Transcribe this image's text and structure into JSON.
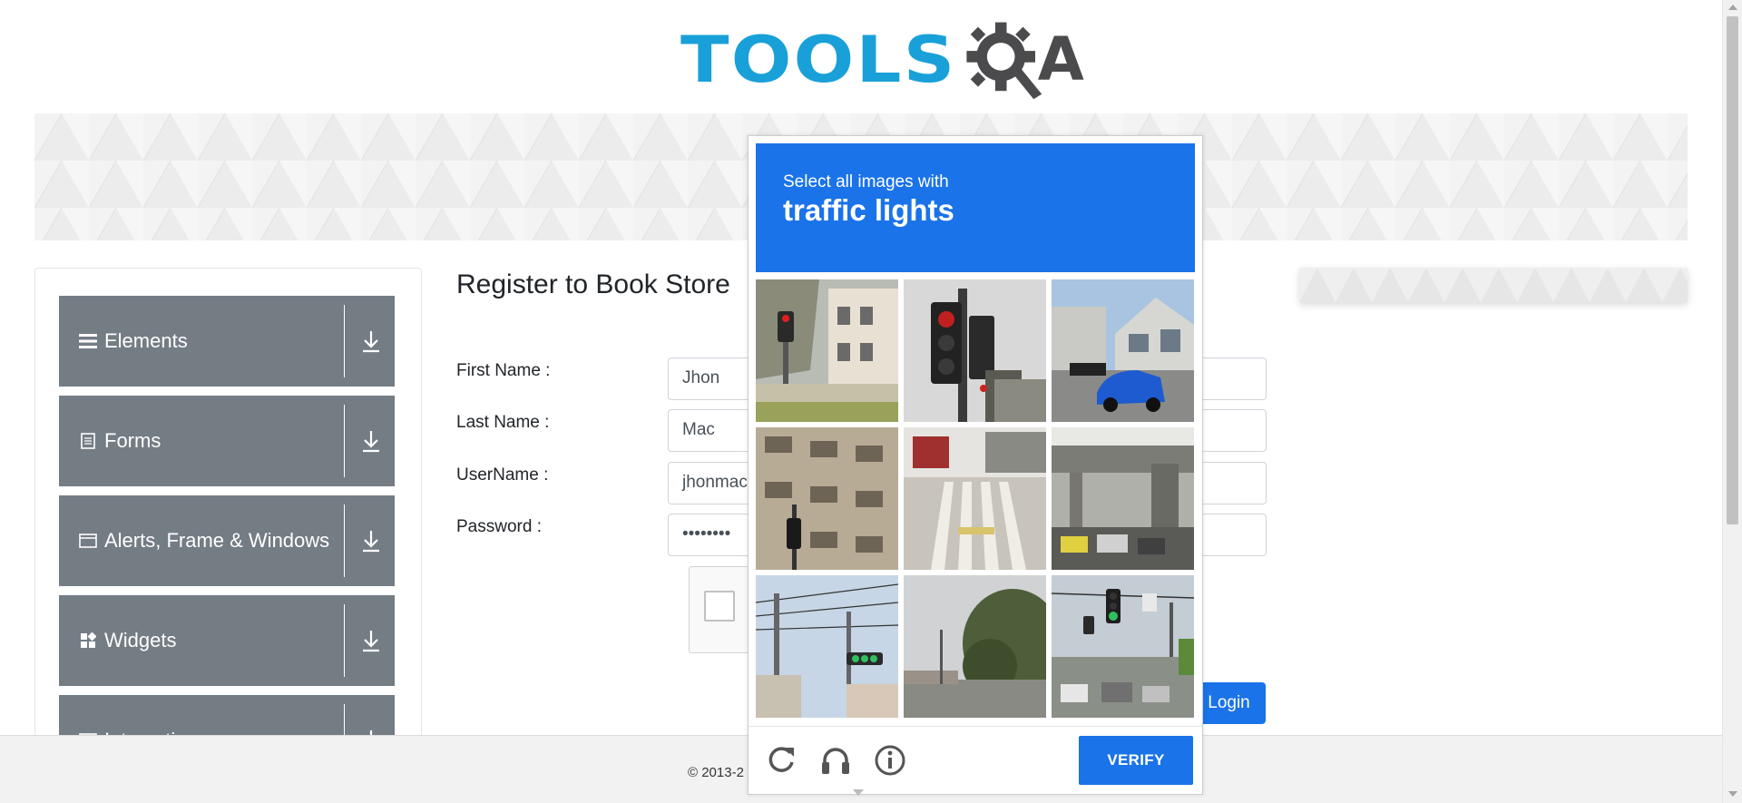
{
  "header": {
    "logo_text": "TOOLSQA",
    "logo_left": "TOOLS",
    "logo_right": "A"
  },
  "sidebar": {
    "groups": [
      {
        "label": "Elements",
        "icon": "hamburger-icon"
      },
      {
        "label": "Forms",
        "icon": "document-icon"
      },
      {
        "label": "Alerts, Frame & Windows",
        "icon": "window-icon"
      },
      {
        "label": "Widgets",
        "icon": "widgets-icon"
      },
      {
        "label": "Interactions",
        "icon": "interactions-icon"
      }
    ]
  },
  "form": {
    "title": "Register to Book Store",
    "fields": [
      {
        "label": "First Name :",
        "value": "Jhon"
      },
      {
        "label": "Last Name :",
        "value": "Mac"
      },
      {
        "label": "UserName :",
        "value": "jhonmac"
      },
      {
        "label": "Password :",
        "value": "••••••••"
      }
    ],
    "login_label": "Login"
  },
  "footer": {
    "text": "© 2013-2"
  },
  "challenge": {
    "instruction": "Select all images with",
    "target": "traffic lights",
    "verify_label": "VERIFY",
    "tiles": [
      "street-corner-with-traffic-light",
      "traffic-light-close-up",
      "house-with-blue-car",
      "building-with-traffic-light",
      "crosswalk-street",
      "overpass-with-cars",
      "power-lines-with-traffic-light",
      "trees-and-street",
      "intersection-with-traffic-lights"
    ],
    "controls": [
      "reload-icon",
      "audio-icon",
      "info-icon"
    ]
  },
  "colors": {
    "accent_blue": "#1a73e8",
    "sidebar_gray": "#747c84",
    "logo_blue": "#1aa0d8",
    "logo_dark": "#4b4b4d"
  }
}
